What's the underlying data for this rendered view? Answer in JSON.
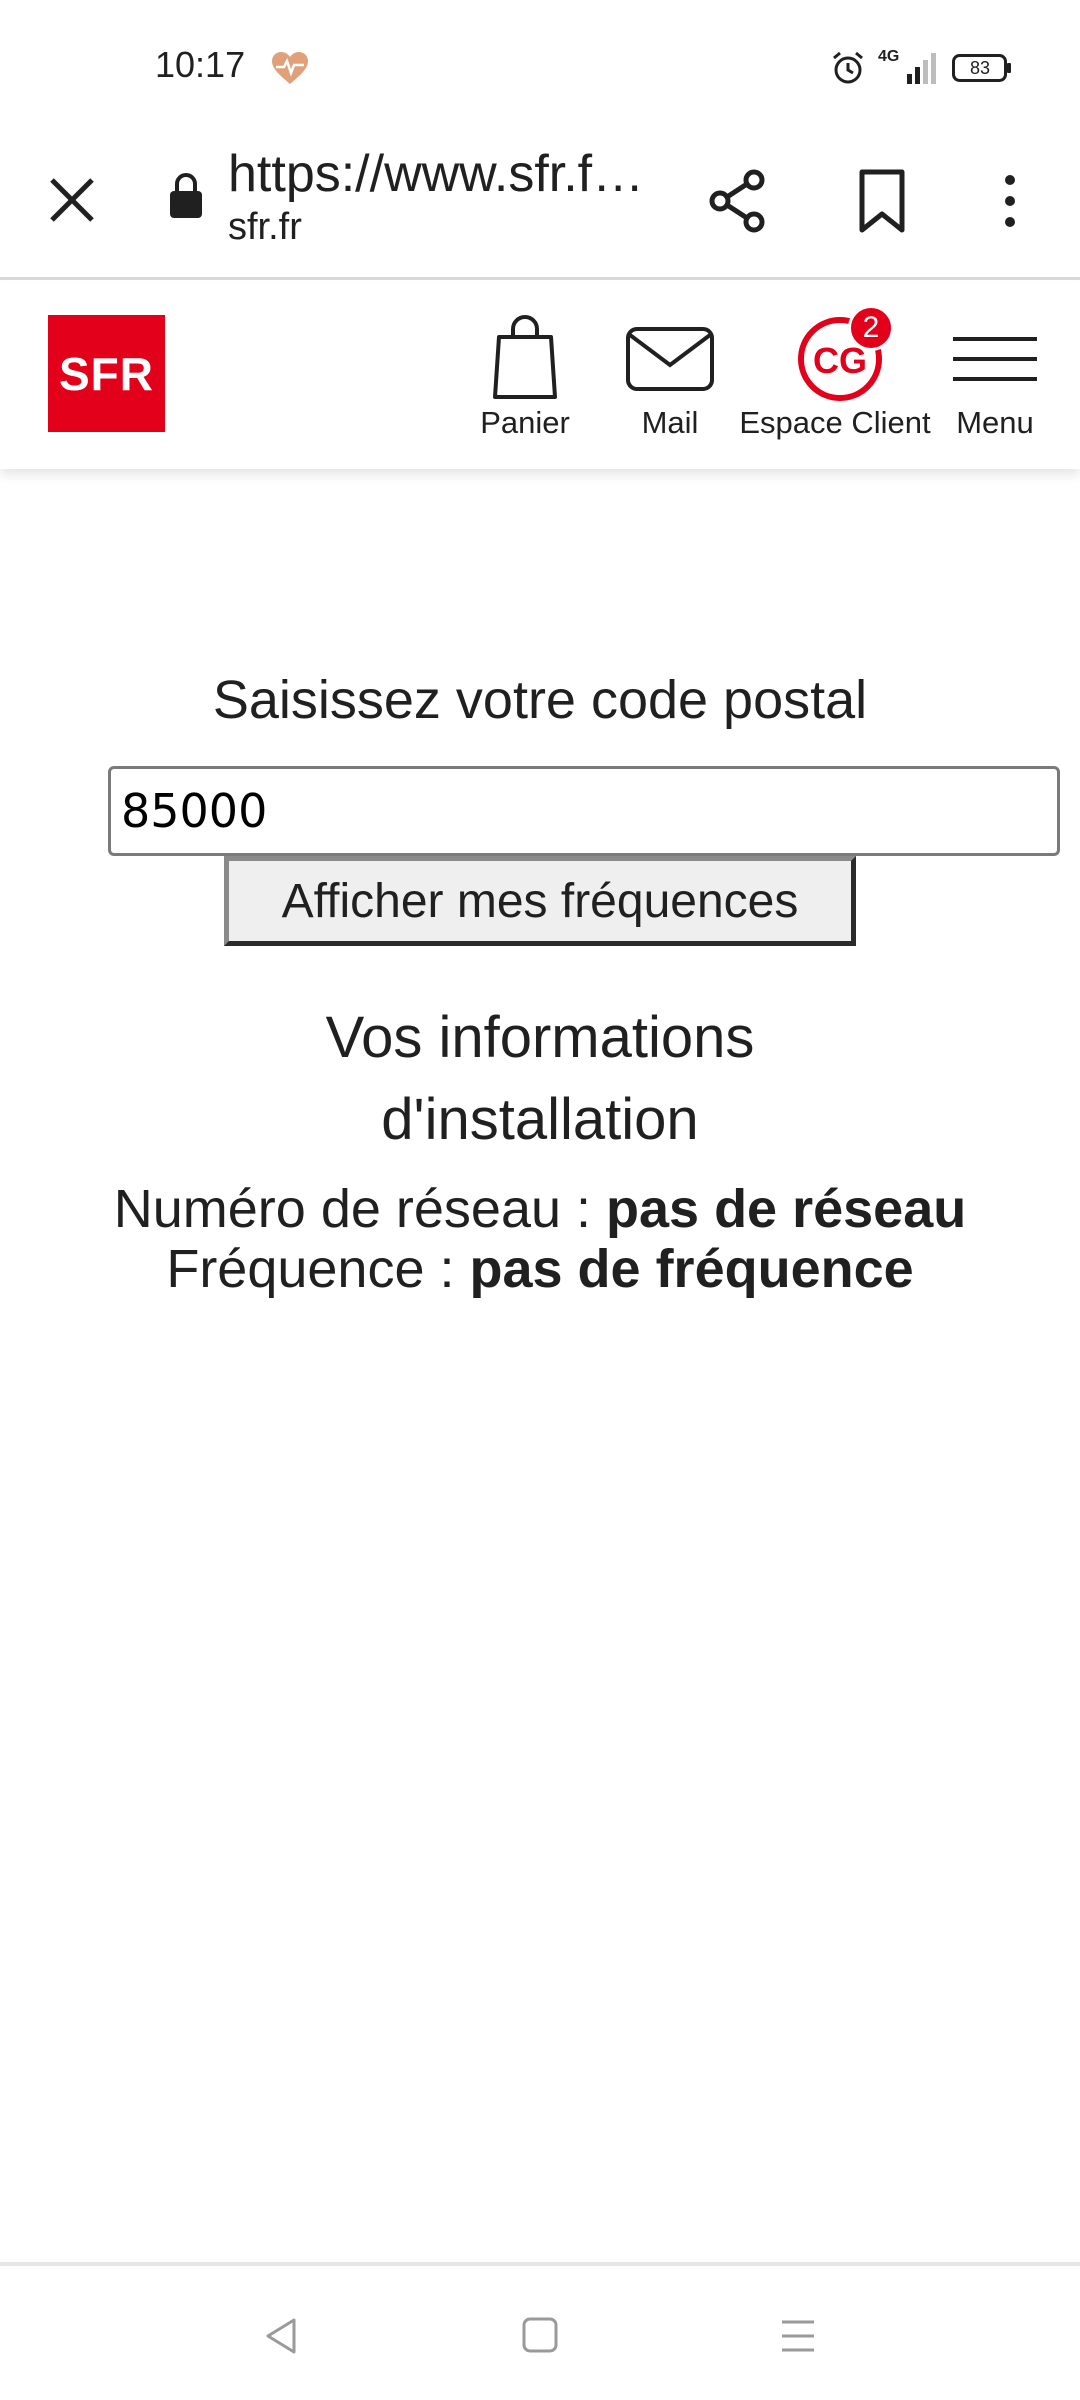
{
  "status_bar": {
    "time": "10:17",
    "network": "4G",
    "battery": "83"
  },
  "browser": {
    "url": "https://www.sfr.fr/...",
    "domain": "sfr.fr"
  },
  "header": {
    "logo_text": "SFR",
    "logo_color": "#e2001a",
    "nav": {
      "panier": "Panier",
      "mail": "Mail",
      "client": "Espace Client",
      "client_initials": "CG",
      "client_badge": "2",
      "menu": "Menu"
    }
  },
  "form": {
    "label": "Saisissez votre code postal",
    "postal_value": "85000",
    "submit_label": "Afficher mes fréquences"
  },
  "results": {
    "title": "Vos informations d'installation",
    "network_label": "Numéro de réseau : ",
    "network_value": "pas de réseau",
    "frequency_label": "Fréquence : ",
    "frequency_value": "pas de fréquence"
  }
}
